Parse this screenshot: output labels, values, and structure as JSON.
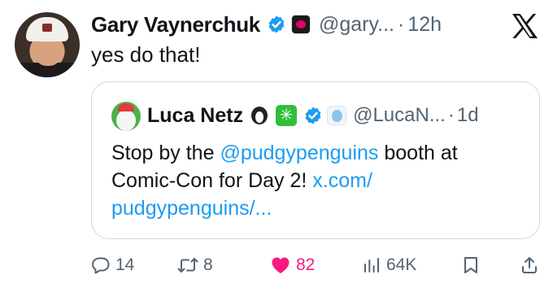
{
  "author": {
    "name": "Gary Vaynerchuk",
    "handle": "@gary...",
    "time": "12h",
    "separator": "·",
    "verified_icon": "verified-badge-icon",
    "affiliate_icon": "affiliate-badge-icon"
  },
  "tweet": {
    "text": "yes do that!"
  },
  "quote": {
    "name": "Luca Netz",
    "handle": "@LucaN...",
    "time": "1d",
    "separator": "·",
    "text_before": "Stop by the ",
    "mention": "@pudgypenguins",
    "text_after": " booth at Comic-Con for Day 2! ",
    "link": "x.com/ pudgypenguins/...",
    "emoji_icons": [
      "penguin-emoji-icon",
      "sparkle-emoji-icon"
    ]
  },
  "actions": {
    "replies": "14",
    "retweets": "8",
    "likes": "82",
    "views": "64K"
  },
  "colors": {
    "accent": "#1d9bf0",
    "like": "#f91880",
    "muted": "#536471",
    "text": "#0f1419",
    "border": "#cfd9de"
  }
}
